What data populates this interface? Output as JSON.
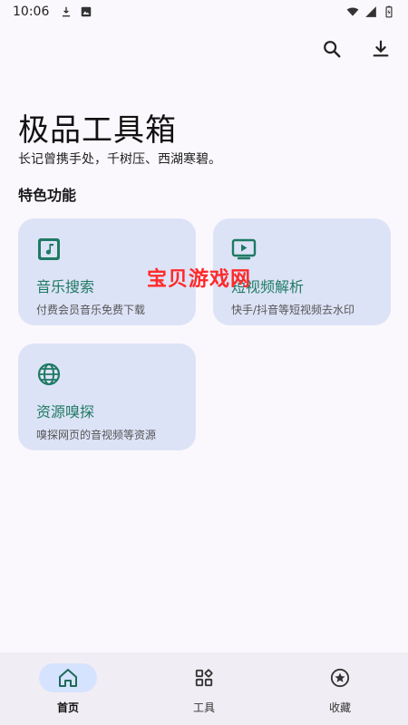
{
  "status_bar": {
    "time": "10:06",
    "icons": [
      "download-icon",
      "image-icon",
      "wifi-icon",
      "signal-icon",
      "battery-icon"
    ]
  },
  "header": {
    "actions": [
      "search-icon",
      "download-icon"
    ]
  },
  "app": {
    "title": "极品工具箱",
    "subtitle": "长记曾携手处，千树压、西湖寒碧。"
  },
  "section": {
    "title": "特色功能"
  },
  "cards": [
    {
      "icon": "music-note-icon",
      "title": "音乐搜索",
      "desc": "付费会员音乐免费下载"
    },
    {
      "icon": "tv-icon",
      "title": "短视频解析",
      "desc": "快手/抖音等短视频去水印"
    },
    {
      "icon": "globe-icon",
      "title": "资源嗅探",
      "desc": "嗅探网页的音视频等资源"
    }
  ],
  "watermark": "宝贝游戏网",
  "bottom_nav": [
    {
      "icon": "home-icon",
      "label": "首页",
      "active": true
    },
    {
      "icon": "tools-icon",
      "label": "工具",
      "active": false
    },
    {
      "icon": "star-icon",
      "label": "收藏",
      "active": false
    }
  ],
  "colors": {
    "accent": "#1f7a63",
    "card_bg": "#dde3f7",
    "nav_active_pill": "#d6e3ff",
    "watermark": "#ff2a2a"
  }
}
